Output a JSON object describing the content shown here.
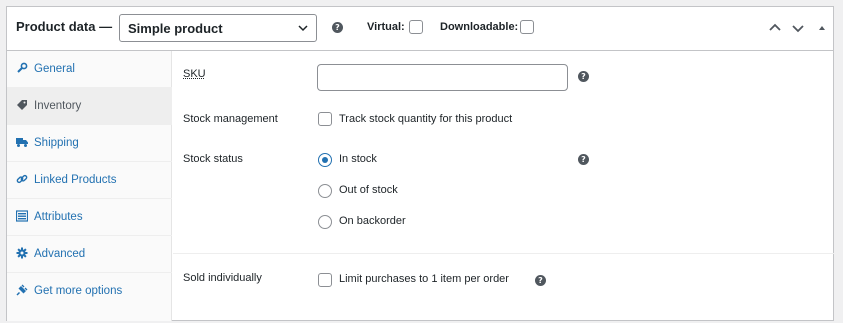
{
  "header": {
    "title": "Product data —",
    "product_type": "Simple product",
    "virtual_label": "Virtual:",
    "downloadable_label": "Downloadable:",
    "help_glyph": "?"
  },
  "sidebar": {
    "items": [
      {
        "label": "General",
        "icon": "wrench-icon"
      },
      {
        "label": "Inventory",
        "icon": "tag-icon"
      },
      {
        "label": "Shipping",
        "icon": "truck-icon"
      },
      {
        "label": "Linked Products",
        "icon": "link-icon"
      },
      {
        "label": "Attributes",
        "icon": "list-icon"
      },
      {
        "label": "Advanced",
        "icon": "gear-icon"
      },
      {
        "label": "Get more options",
        "icon": "plugin-icon"
      }
    ],
    "active_item": "Inventory"
  },
  "inventory": {
    "sku_label": "SKU",
    "sku_value": "",
    "stock_management_label": "Stock management",
    "stock_management_option": "Track stock quantity for this product",
    "stock_status_label": "Stock status",
    "stock_status_options": [
      "In stock",
      "Out of stock",
      "On backorder"
    ],
    "stock_status_selected": "In stock",
    "sold_individually_label": "Sold individually",
    "sold_individually_option": "Limit purchases to 1 item per order"
  },
  "colors": {
    "link": "#2271b1",
    "border": "#c3c4c7",
    "text": "#1d2327"
  }
}
